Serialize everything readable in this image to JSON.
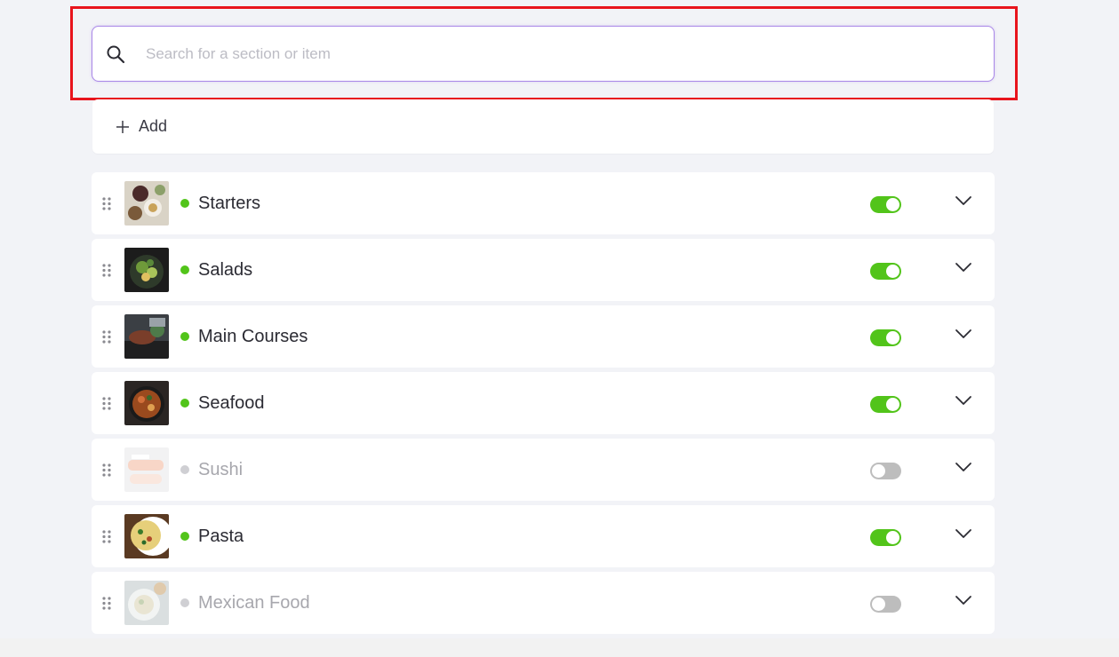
{
  "search": {
    "placeholder": "Search for a section or item",
    "value": "",
    "icon": "search-icon"
  },
  "add": {
    "label": "Add",
    "icon": "plus-icon"
  },
  "colors": {
    "active_green": "#52c41a",
    "inactive_gray": "#cfcfd3",
    "toggle_off": "#bdbdbd",
    "highlight_red": "#e8141c",
    "focus_purple": "#a987e8"
  },
  "sections": [
    {
      "name": "Starters",
      "active": true,
      "enabled": true
    },
    {
      "name": "Salads",
      "active": true,
      "enabled": true
    },
    {
      "name": "Main Courses",
      "active": true,
      "enabled": true
    },
    {
      "name": "Seafood",
      "active": true,
      "enabled": true
    },
    {
      "name": "Sushi",
      "active": false,
      "enabled": false
    },
    {
      "name": "Pasta",
      "active": true,
      "enabled": true
    },
    {
      "name": "Mexican Food",
      "active": false,
      "enabled": false
    }
  ]
}
